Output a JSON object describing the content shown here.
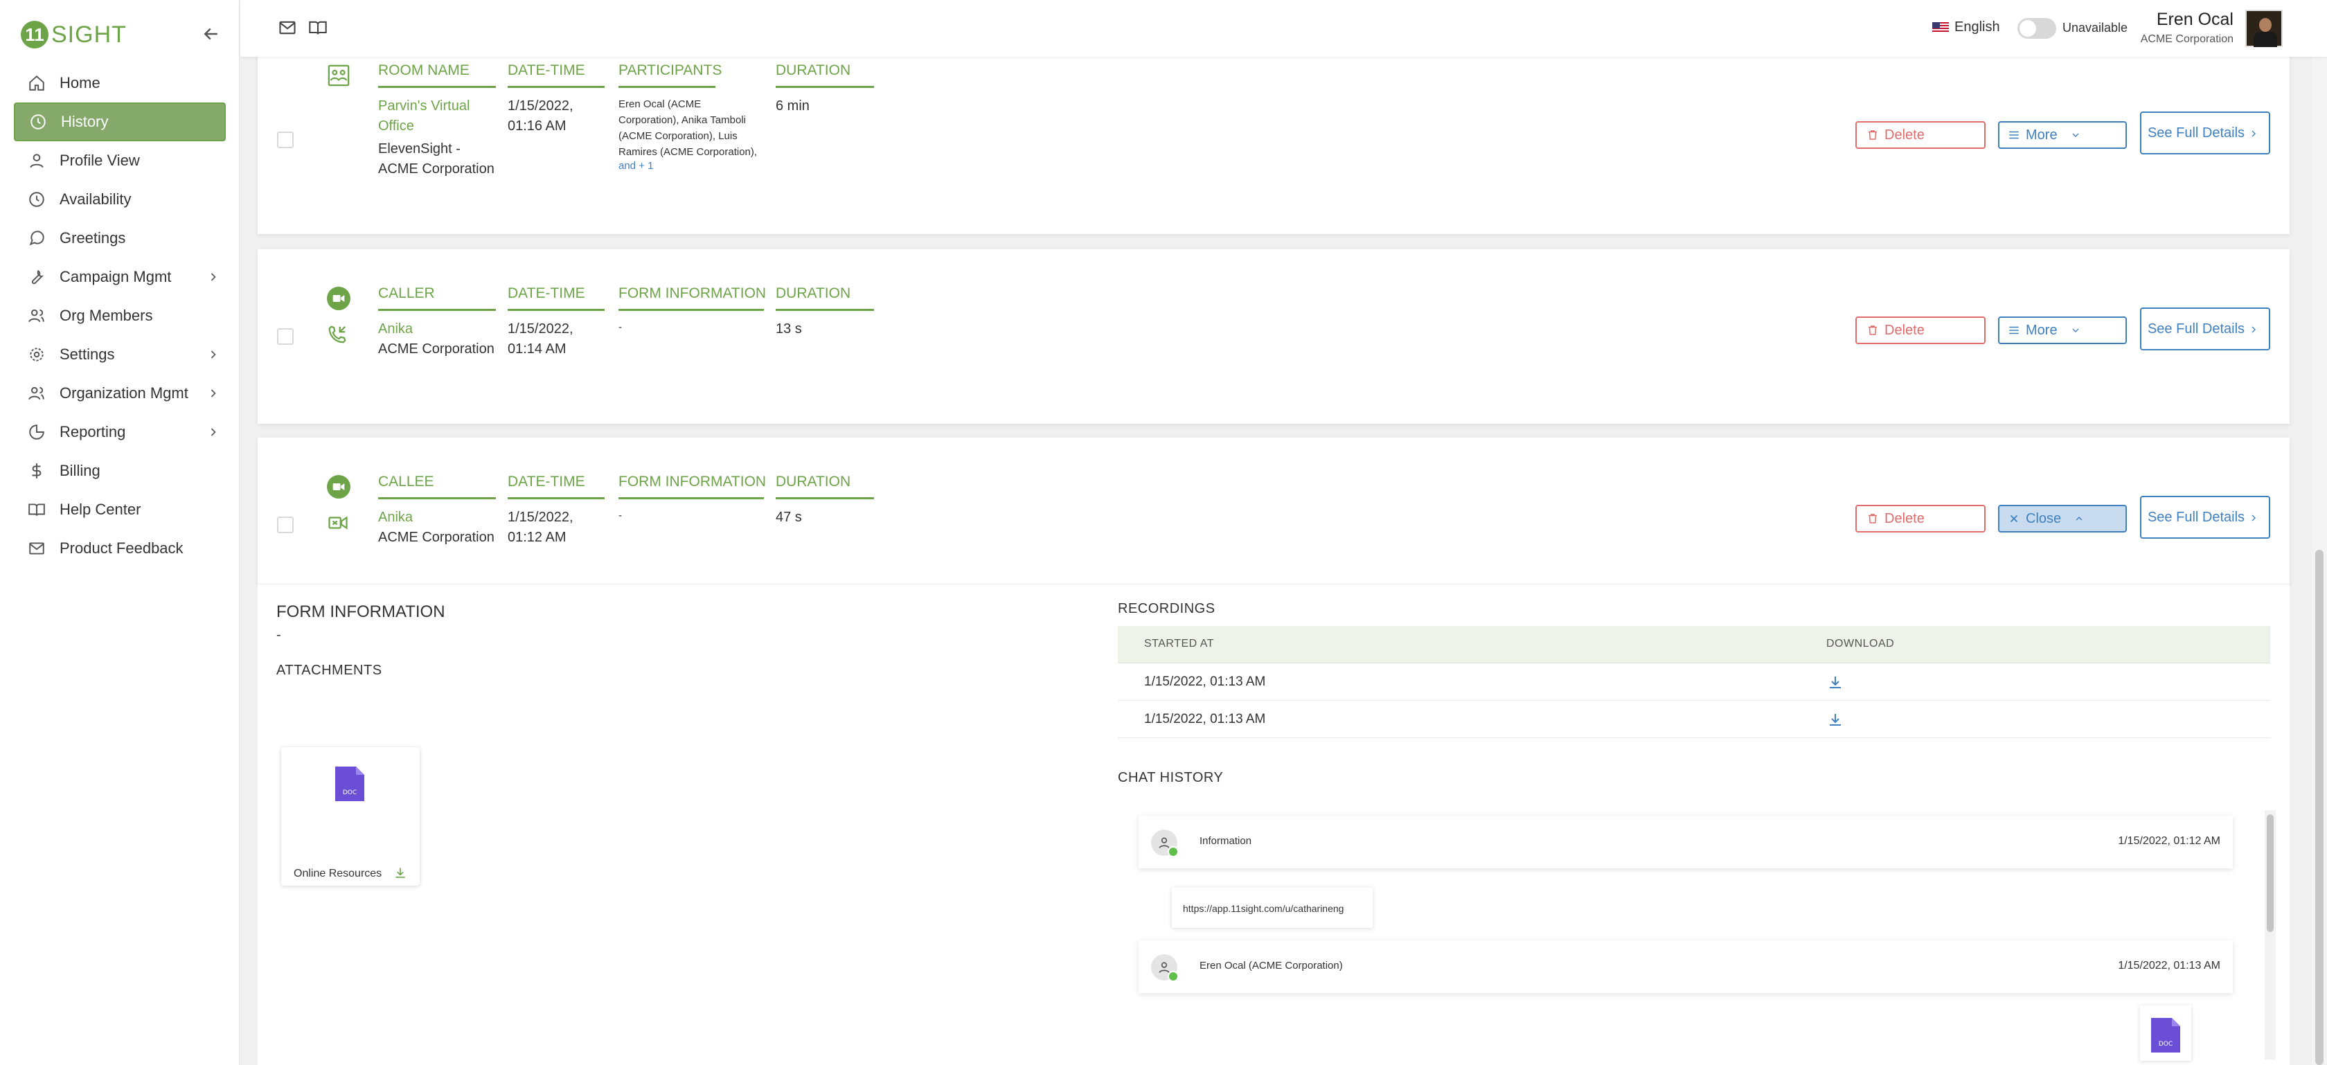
{
  "brand": {
    "logo_letter": "11",
    "logo_text": "SIGHT"
  },
  "sidebar": {
    "items": [
      {
        "label": "Home",
        "icon": "home-icon"
      },
      {
        "label": "History",
        "icon": "clock-icon",
        "active": true
      },
      {
        "label": "Profile View",
        "icon": "user-icon"
      },
      {
        "label": "Availability",
        "icon": "clock-icon"
      },
      {
        "label": "Greetings",
        "icon": "chat-bubble-icon"
      },
      {
        "label": "Campaign Mgmt",
        "icon": "wrench-icon",
        "has_submenu": true
      },
      {
        "label": "Org Members",
        "icon": "users-icon"
      },
      {
        "label": "Settings",
        "icon": "gear-icon",
        "has_submenu": true
      },
      {
        "label": "Organization Mgmt",
        "icon": "users-icon",
        "has_submenu": true
      },
      {
        "label": "Reporting",
        "icon": "pie-chart-icon",
        "has_submenu": true
      },
      {
        "label": "Billing",
        "icon": "dollar-icon"
      },
      {
        "label": "Help Center",
        "icon": "book-icon"
      },
      {
        "label": "Product Feedback",
        "icon": "mail-icon"
      }
    ]
  },
  "topbar": {
    "language": "English",
    "availability": "Unavailable",
    "user_name": "Eren Ocal",
    "user_org": "ACME Corporation"
  },
  "records": [
    {
      "type": "room",
      "headers": [
        "ROOM NAME",
        "DATE-TIME",
        "PARTICIPANTS",
        "DURATION"
      ],
      "room_name": "Parvin's Virtual Office",
      "room_org": "ElevenSight - ACME Corporation",
      "datetime": "1/15/2022, 01:16 AM",
      "participants": "Eren Ocal (ACME Corporation), Anika Tamboli (ACME Corporation), Luis Ramires (ACME Corporation),",
      "participants_more": "and + 1",
      "duration": "6 min",
      "delete_label": "Delete",
      "more_label": "More",
      "details_label": "See Full Details"
    },
    {
      "type": "incoming-call",
      "headers": [
        "CALLER",
        "DATE-TIME",
        "FORM INFORMATION",
        "DURATION"
      ],
      "person": "Anika",
      "org": "ACME Corporation",
      "datetime": "1/15/2022, 01:14 AM",
      "form_info": "-",
      "duration": "13 s",
      "delete_label": "Delete",
      "more_label": "More",
      "details_label": "See Full Details"
    },
    {
      "type": "outgoing-video",
      "headers": [
        "CALLEE",
        "DATE-TIME",
        "FORM INFORMATION",
        "DURATION"
      ],
      "person": "Anika",
      "org": "ACME Corporation",
      "datetime": "1/15/2022, 01:12 AM",
      "form_info": "-",
      "duration": "47 s",
      "delete_label": "Delete",
      "close_label": "Close",
      "details_label": "See Full Details"
    }
  ],
  "expanded": {
    "form_title": "FORM INFORMATION",
    "form_value": "-",
    "attachments_title": "ATTACHMENTS",
    "attachment": {
      "name": "Online Resources",
      "badge": "DOC"
    },
    "recordings_title": "RECORDINGS",
    "recordings_headers": [
      "STARTED AT",
      "DOWNLOAD"
    ],
    "recordings": [
      "1/15/2022, 01:13 AM",
      "1/15/2022, 01:13 AM"
    ],
    "chat_title": "CHAT HISTORY",
    "chat": [
      {
        "name": "Information",
        "time": "1/15/2022, 01:12 AM"
      },
      {
        "bubble": "https://app.11sight.com/u/catharineng"
      },
      {
        "name": "Eren Ocal (ACME Corporation)",
        "time": "1/15/2022, 01:13 AM"
      },
      {
        "doc_badge": "DOC"
      }
    ]
  }
}
